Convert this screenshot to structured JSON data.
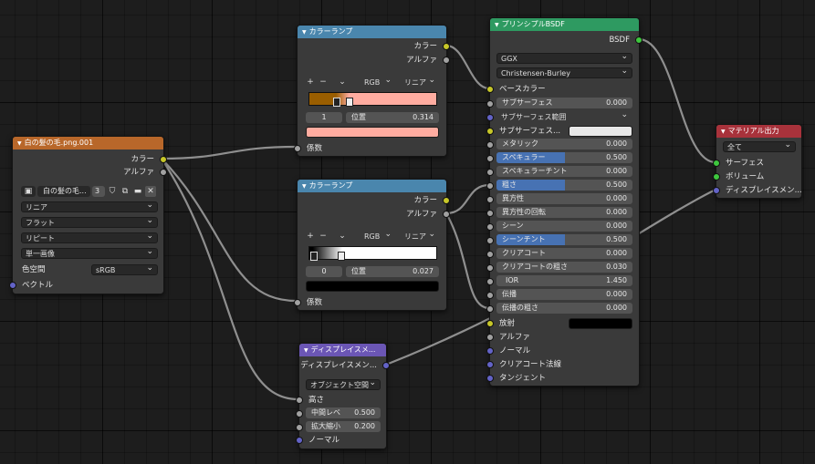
{
  "image_node": {
    "title": "白の髪の毛.png.001",
    "outputs": [
      "カラー",
      "アルファ"
    ],
    "image_name": "白の髪の毛...",
    "user_count": "3",
    "interpolation": "リニア",
    "projection": "フラット",
    "extension": "リピート",
    "source": "単一画像",
    "colorspace_label": "色空間",
    "colorspace_value": "sRGB",
    "vector_label": "ベクトル"
  },
  "ramp1": {
    "title": "カラーランプ",
    "outputs": [
      "カラー",
      "アルファ"
    ],
    "mode": "RGB",
    "interp": "リニア",
    "index": "1",
    "pos_label": "位置",
    "pos_value": "0.314",
    "input": "係数",
    "left_color": "#9a5e00",
    "right_color": "#ffaca0"
  },
  "ramp2": {
    "title": "カラーランプ",
    "outputs": [
      "カラー",
      "アルファ"
    ],
    "mode": "RGB",
    "interp": "リニア",
    "index": "0",
    "pos_label": "位置",
    "pos_value": "0.027",
    "input": "係数",
    "swatch_color": "#000000"
  },
  "disp": {
    "title": "ディスプレイスメ...",
    "output": "ディスプレイスメン...",
    "space": "オブジェクト空間",
    "height_label": "高さ",
    "mid_label": "中間レベ",
    "mid_value": "0.500",
    "scale_label": "拡大縮小",
    "scale_value": "0.200",
    "normal_label": "ノーマル"
  },
  "bsdf": {
    "title": "プリンシプルBSDF",
    "output": "BSDF",
    "distribution": "GGX",
    "subsurface_method": "Christensen-Burley",
    "base_color_label": "ベースカラー",
    "subsurface_label": "サブサーフェス",
    "subsurface_value": "0.000",
    "subsurface_radius_label": "サブサーフェス範囲",
    "subsurface_color_label": "サブサーフェス...",
    "metallic_label": "メタリック",
    "metallic_value": "0.000",
    "specular_label": "スペキュラー",
    "specular_value": "0.500",
    "specular_fill": 0.5,
    "spec_tint_label": "スペキュラーチント",
    "spec_tint_value": "0.000",
    "roughness_label": "粗さ",
    "roughness_value": "0.500",
    "roughness_fill": 0.5,
    "aniso_label": "異方性",
    "aniso_value": "0.000",
    "aniso_rot_label": "異方性の回転",
    "aniso_rot_value": "0.000",
    "sheen_label": "シーン",
    "sheen_value": "0.000",
    "sheen_tint_label": "シーンチント",
    "sheen_tint_value": "0.500",
    "sheen_tint_fill": 0.5,
    "clearcoat_label": "クリアコート",
    "clearcoat_value": "0.000",
    "clearcoat_rough_label": "クリアコートの粗さ",
    "clearcoat_rough_value": "0.030",
    "ior_label": "IOR",
    "ior_value": "1.450",
    "transmission_label": "伝播",
    "transmission_value": "0.000",
    "trans_rough_label": "伝播の粗さ",
    "trans_rough_value": "0.000",
    "emission_label": "放射",
    "alpha_label": "アルファ",
    "normal_label": "ノーマル",
    "clearcoat_normal_label": "クリアコート法線",
    "tangent_label": "タンジェント"
  },
  "output_node": {
    "title": "マテリアル出力",
    "target": "全て",
    "inputs": [
      "サーフェス",
      "ボリューム",
      "ディスプレイスメン..."
    ]
  },
  "colors": {
    "image_header": "#b8672a",
    "ramp_header": "#4a86ad",
    "disp_header": "#6b56b5",
    "bsdf_header": "#2e9a61",
    "output_header": "#a8323b"
  }
}
